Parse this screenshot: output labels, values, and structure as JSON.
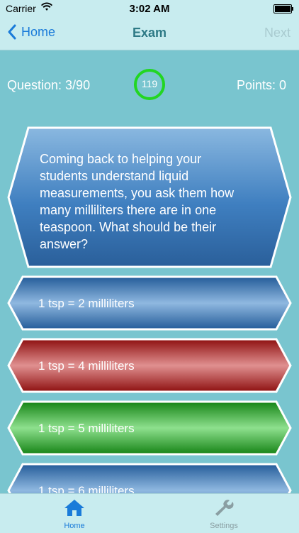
{
  "status_bar": {
    "carrier": "Carrier",
    "time": "3:02 AM"
  },
  "nav": {
    "back_label": "Home",
    "title": "Exam",
    "next_label": "Next"
  },
  "score": {
    "question": "Question: 3/90",
    "timer": "119",
    "points": "Points: 0"
  },
  "question": {
    "line1": " Coming back to helping your",
    "line2": "students understand liquid",
    "line3": "measurements, you ask them how",
    "line4": "many milliliters there are in one",
    "line5": "teaspoon. What should be their",
    "line6": "answer?"
  },
  "answers": [
    {
      "label": "1 tsp = 2 milliliters",
      "color": "blue"
    },
    {
      "label": "1 tsp = 4 milliliters",
      "color": "red"
    },
    {
      "label": "1 tsp = 5 milliliters",
      "color": "green"
    },
    {
      "label": "1 tsp = 6 milliliters",
      "color": "blue"
    }
  ],
  "tabs": [
    {
      "label": "Home",
      "icon": "home-icon",
      "active": true
    },
    {
      "label": "Settings",
      "icon": "wrench-icon",
      "active": false
    }
  ],
  "colors": {
    "background": "#79c5cf",
    "accent": "#1a7bd9",
    "timer_ring": "#22d622",
    "blue_answer": "#2e6fb0",
    "red_answer": "#a01818",
    "green_answer": "#1d9a1d"
  }
}
